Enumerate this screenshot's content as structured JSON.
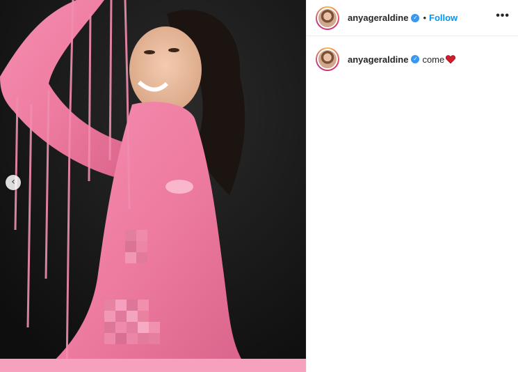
{
  "post": {
    "username": "anyageraldine",
    "follow_label": "Follow",
    "separator": "•",
    "more_label": "•••",
    "caption": {
      "username": "anyageraldine",
      "text": "come",
      "emoji": "heart-icon"
    }
  },
  "media": {
    "carousel_prev_label": "‹"
  },
  "colors": {
    "accent": "#0095f6",
    "verified": "#3897f0",
    "heart": "#d21c2c",
    "paint": "#f07aa0",
    "background_dark": "#131313"
  }
}
